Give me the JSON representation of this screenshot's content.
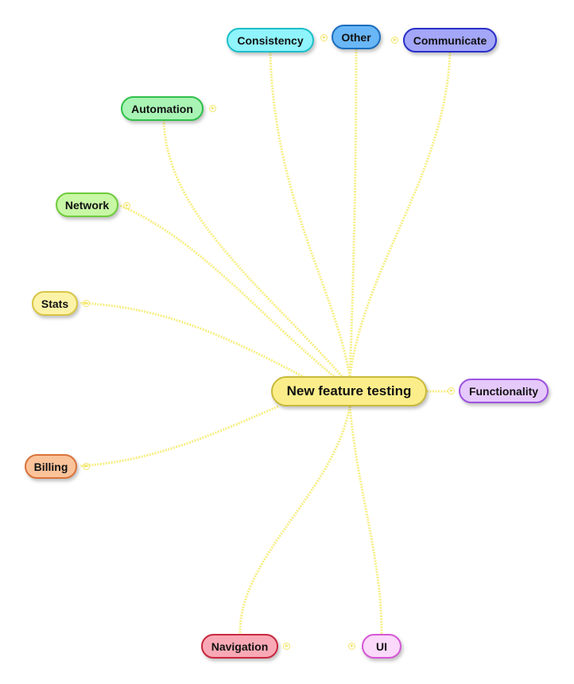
{
  "root": {
    "id": "root",
    "label": "New feature testing",
    "fill": "#fbee8a",
    "border": "#c9b93a"
  },
  "nodes": [
    {
      "id": "consistency",
      "label": "Consistency",
      "fill": "#8ff4fb",
      "border": "#1cbfca"
    },
    {
      "id": "other",
      "label": "Other",
      "fill": "#6ab7f7",
      "border": "#1a6dbd"
    },
    {
      "id": "communicate",
      "label": "Communicate",
      "fill": "#a4a6f7",
      "border": "#2a30c9"
    },
    {
      "id": "automation",
      "label": "Automation",
      "fill": "#a9f3b5",
      "border": "#2fc04a"
    },
    {
      "id": "network",
      "label": "Network",
      "fill": "#c8f7a6",
      "border": "#6fcc3b"
    },
    {
      "id": "stats",
      "label": "Stats",
      "fill": "#fdf3a8",
      "border": "#d8c545"
    },
    {
      "id": "functionality",
      "label": "Functionality",
      "fill": "#e6c9fb",
      "border": "#9d52e0"
    },
    {
      "id": "billing",
      "label": "Billing",
      "fill": "#fbc39a",
      "border": "#d9733a"
    },
    {
      "id": "navigation",
      "label": "Navigation",
      "fill": "#f9a9b5",
      "border": "#c9283f"
    },
    {
      "id": "ui",
      "label": "UI",
      "fill": "#fbd9fb",
      "border": "#d657d6"
    }
  ],
  "link_color": "#f7ee82"
}
